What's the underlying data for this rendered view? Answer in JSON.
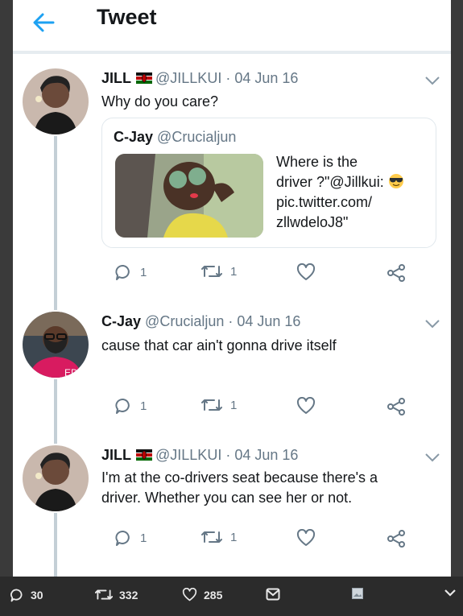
{
  "header": {
    "title": "Tweet",
    "back_icon": "back-arrow-icon"
  },
  "tweets": [
    {
      "name": "JILL",
      "handle": "@JILLKUI",
      "date": "· 04 Jun 16",
      "text": "Why do you care?",
      "quote": {
        "name": "C-Jay",
        "handle": "@Crucialjun",
        "text_lines": [
          "Where is the",
          "driver ?\"@Jillkui:",
          "pic.twitter.com/",
          "zllwdeloJ8\""
        ]
      },
      "replies": "1",
      "retweets": "1"
    },
    {
      "name": "C-Jay",
      "handle": "@Crucialjun",
      "date": "· 04 Jun 16",
      "text": "cause that car ain't gonna drive itself",
      "replies": "1",
      "retweets": "1"
    },
    {
      "name": "JILL",
      "handle": "@JILLKUI",
      "date": "· 04 Jun 16",
      "text_lines": [
        "I'm at the co-drivers seat because there's a",
        "driver. Whether you can see her or not."
      ],
      "replies": "1",
      "retweets": "1"
    }
  ],
  "bottom_bar": {
    "replies": "30",
    "retweets": "332",
    "likes": "285"
  },
  "colors": {
    "accent": "#1da1f2",
    "muted": "#657786",
    "text": "#14171a"
  }
}
